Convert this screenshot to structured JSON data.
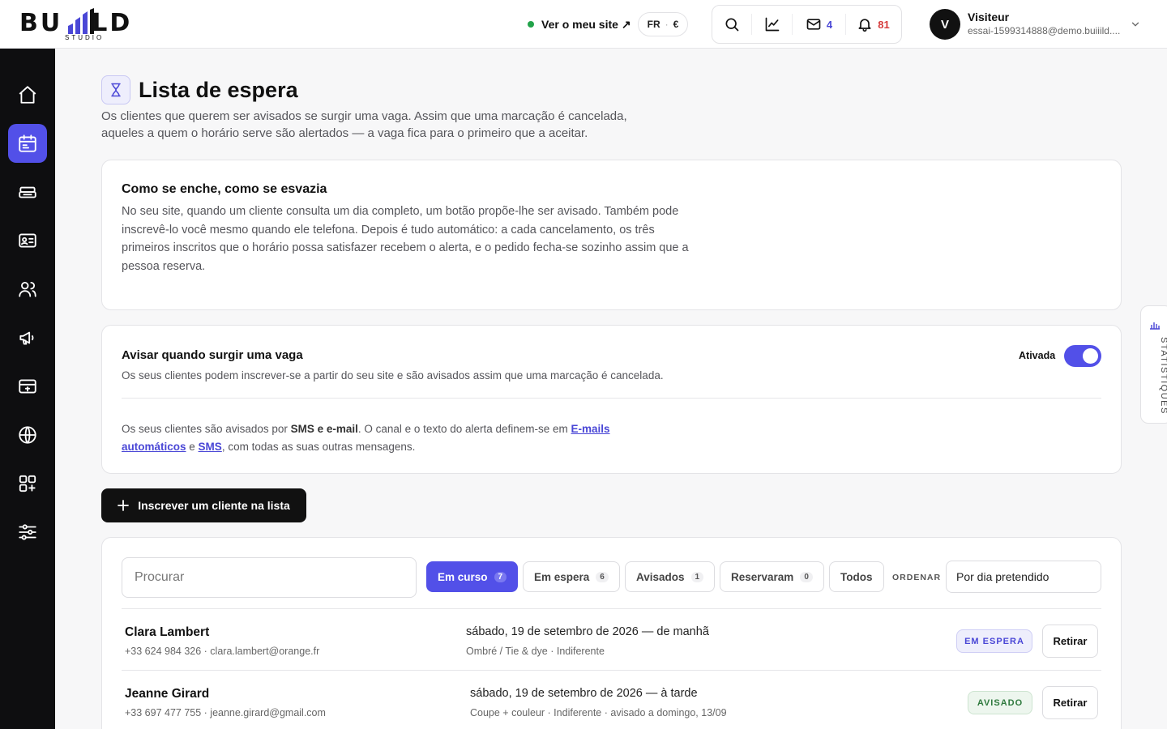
{
  "brand": {
    "wordmark": "BU LD",
    "sub": "STUDIO",
    "bar_color": "#4a47d6"
  },
  "header": {
    "site_link": "Ver o meu site ↗",
    "lang": "FR",
    "currency": "€",
    "mail_count": "4",
    "notif_count": "81",
    "user": {
      "initial": "V",
      "name": "Visiteur",
      "email": "essai-1599314888@demo.buiiild...."
    }
  },
  "sidebar": {
    "items": [
      {
        "icon": "home-icon"
      },
      {
        "icon": "calendar-icon",
        "active": true
      },
      {
        "icon": "service-icon"
      },
      {
        "icon": "contact-card-icon"
      },
      {
        "icon": "users-icon"
      },
      {
        "icon": "megaphone-icon"
      },
      {
        "icon": "payment-card-icon"
      },
      {
        "icon": "globe-icon"
      },
      {
        "icon": "apps-icon"
      },
      {
        "icon": "settings-sliders-icon"
      }
    ]
  },
  "side_tab": {
    "label": "STATISTIQUES"
  },
  "page": {
    "title": "Lista de espera",
    "description": "Os clientes que querem ser avisados se surgir uma vaga. Assim que uma marcação é cancelada, aqueles a quem o horário serve são alertados — a vaga fica para o primeiro que a aceitar."
  },
  "info_card": {
    "title": "Como se enche, como se esvazia",
    "body": "No seu site, quando um cliente consulta um dia completo, um botão propõe-lhe ser avisado. Também pode inscrevê-lo você mesmo quando ele telefona. Depois é tudo automático: a cada cancelamento, os três primeiros inscritos que o horário possa satisfazer recebem o alerta, e o pedido fecha-se sozinho assim que a pessoa reserva."
  },
  "settings_card": {
    "title": "Avisar quando surgir uma vaga",
    "description": "Os seus clientes podem inscrever-se a partir do seu site e são avisados assim que uma marcação é cancelada.",
    "toggle_label": "Ativada",
    "toggle_on": true,
    "note_prefix": "Os seus clientes são avisados por ",
    "note_channels": "SMS e e-mail",
    "note_middle": ". O canal e o texto do alerta definem-se em ",
    "note_link1": "E-mails automáticos",
    "note_and": " e ",
    "note_link2": "SMS",
    "note_suffix": ", com todas as suas outras mensagens."
  },
  "add_button": "Inscrever um cliente na lista",
  "list": {
    "search_placeholder": "Procurar",
    "filters": [
      {
        "label": "Em curso",
        "count": "7",
        "active": true
      },
      {
        "label": "Em espera",
        "count": "6"
      },
      {
        "label": "Avisados",
        "count": "1"
      },
      {
        "label": "Reservaram",
        "count": "0"
      },
      {
        "label": "Todos"
      }
    ],
    "order_label": "ORDENAR",
    "order_value": "Por dia pretendido",
    "rows": [
      {
        "name": "Clara Lambert",
        "contact": "+33 624 984 326 · clara.lambert@orange.fr",
        "date": "sábado, 19 de setembro de 2026 — de manhã",
        "detail": "Ombré / Tie & dye · Indiferente",
        "status": "EM ESPERA",
        "action": "Retirar"
      },
      {
        "name": "Jeanne Girard",
        "contact": "+33 697 477 755 · jeanne.girard@gmail.com",
        "date": "sábado, 19 de setembro de 2026 — à tarde",
        "detail": "Coupe + couleur · Indiferente · avisado a domingo, 13/09",
        "status": "AVISADO",
        "action": "Retirar"
      }
    ]
  }
}
